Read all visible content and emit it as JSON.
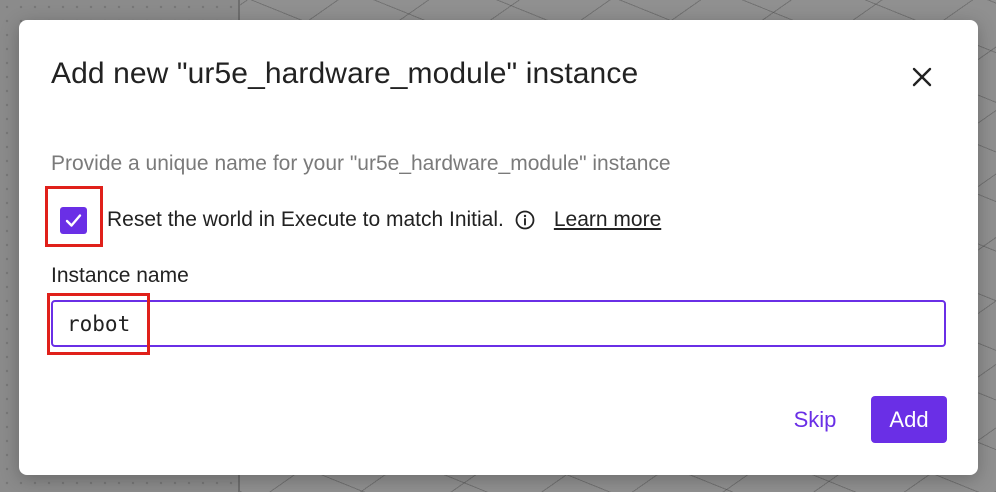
{
  "dialog": {
    "title": "Add new \"ur5e_hardware_module\" instance",
    "description": "Provide a unique name for your \"ur5e_hardware_module\" instance",
    "reset_checkbox": {
      "checked": true,
      "label": "Reset the world in Execute to match Initial.",
      "learn_more": "Learn more"
    },
    "instance_name": {
      "label": "Instance name",
      "value": "robot"
    },
    "buttons": {
      "skip": "Skip",
      "add": "Add"
    }
  },
  "icons": {
    "close": "close-icon",
    "checkmark": "checkmark-icon",
    "info": "info-icon"
  },
  "colors": {
    "accent": "#6a2fe6",
    "highlight": "#e0201a",
    "text": "#222222",
    "muted_text": "#7a7a7a"
  }
}
